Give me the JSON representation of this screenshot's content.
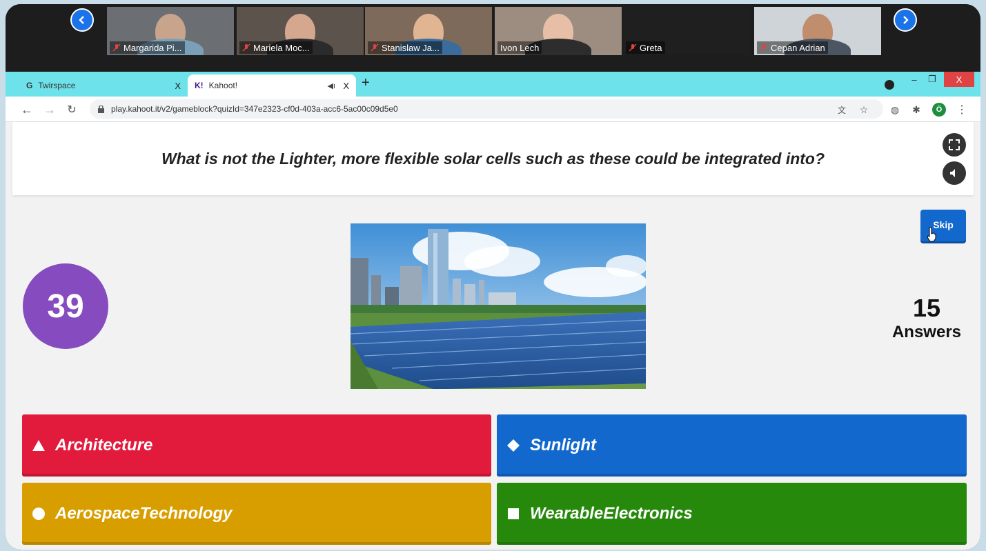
{
  "meeting": {
    "participants": [
      {
        "name": "Margarida Pi...",
        "mic_muted": true
      },
      {
        "name": "Mariela Moc...",
        "mic_muted": true
      },
      {
        "name": "Stanislaw Ja...",
        "mic_muted": true
      },
      {
        "name": "Ivon Lech",
        "mic_muted": false
      },
      {
        "name": "Greta",
        "mic_muted": true
      },
      {
        "name": "Cepan Adrian",
        "mic_muted": true
      }
    ]
  },
  "browser": {
    "tabs": [
      {
        "label": "Twirspace",
        "favicon": "G",
        "close": "X"
      },
      {
        "label": "Kahoot!",
        "favicon": "K!",
        "close": "X"
      }
    ],
    "new_tab": "+",
    "url": "play.kahoot.it/v2/gameblock?quizId=347e2323-cf0d-403a-acc6-5ac00c09d5e0",
    "profile_initial": "Ö",
    "window_close": "X"
  },
  "kahoot": {
    "question": "What is not the Lighter, more flexible solar cells such as these could be integrated into?",
    "skip_label": "Skip",
    "timer": "39",
    "answers_count": "15",
    "answers_label": "Answers",
    "options": [
      {
        "shape": "triangle-icon",
        "label": "Architecture",
        "color": "#e21b3c"
      },
      {
        "shape": "diamond-icon",
        "label": "Sunlight",
        "color": "#1368ce"
      },
      {
        "shape": "circle-icon",
        "label": "AerospaceTechnology",
        "color": "#d89e00"
      },
      {
        "shape": "square-icon",
        "label": "WearableElectronics",
        "color": "#26890c"
      }
    ]
  },
  "colors": {
    "kahoot_purple": "#864cbf",
    "tab_bar": "#6ee2ea",
    "skip_blue": "#1368ce"
  }
}
